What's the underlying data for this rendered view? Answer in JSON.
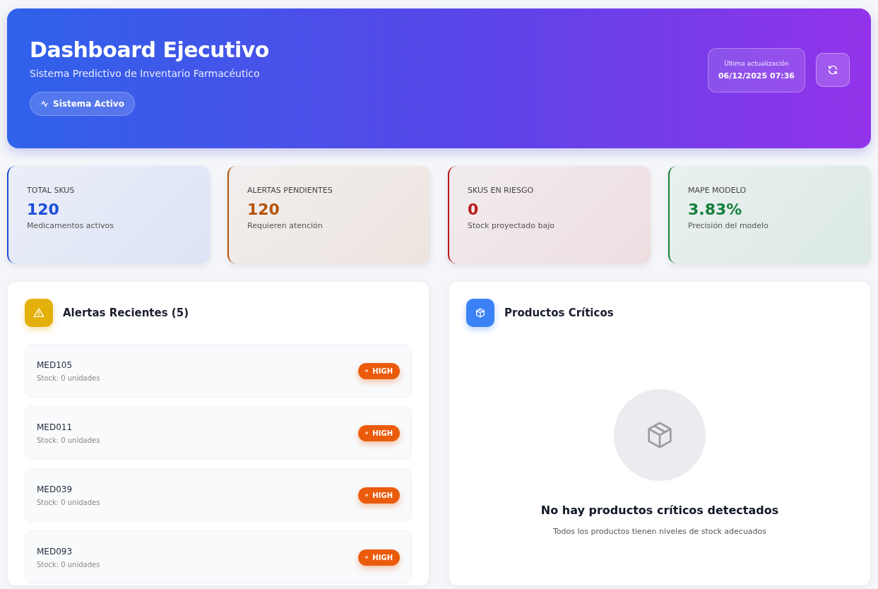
{
  "header": {
    "title": "Dashboard Ejecutivo",
    "subtitle": "Sistema Predictivo de Inventario Farmacéutico",
    "status": "Sistema Activo",
    "update_label": "Última actualización",
    "update_time": "06/12/2025 07:36"
  },
  "stats": [
    {
      "label": "TOTAL SKUS",
      "value": "120",
      "caption": "Medicamentos activos",
      "color": "#1d4ed8"
    },
    {
      "label": "ALERTAS PENDIENTES",
      "value": "120",
      "caption": "Requieren atención",
      "color": "#b45309"
    },
    {
      "label": "SKUS EN RIESGO",
      "value": "0",
      "caption": "Stock proyectado bajo",
      "color": "#b91c1c"
    },
    {
      "label": "MAPE MODELO",
      "value": "3.83%",
      "caption": "Precisión del modelo",
      "color": "#15803d"
    }
  ],
  "alerts_panel": {
    "title": "Alertas Recientes (5)",
    "items": [
      {
        "sku": "MED105",
        "detail": "Stock: 0 unidades",
        "badge": "HIGH"
      },
      {
        "sku": "MED011",
        "detail": "Stock: 0 unidades",
        "badge": "HIGH"
      },
      {
        "sku": "MED039",
        "detail": "Stock: 0 unidades",
        "badge": "HIGH"
      },
      {
        "sku": "MED093",
        "detail": "Stock: 0 unidades",
        "badge": "HIGH"
      }
    ]
  },
  "critical_panel": {
    "title": "Productos Críticos",
    "empty_title": "No hay productos críticos detectados",
    "empty_text": "Todos los productos tienen niveles de stock adecuados"
  }
}
